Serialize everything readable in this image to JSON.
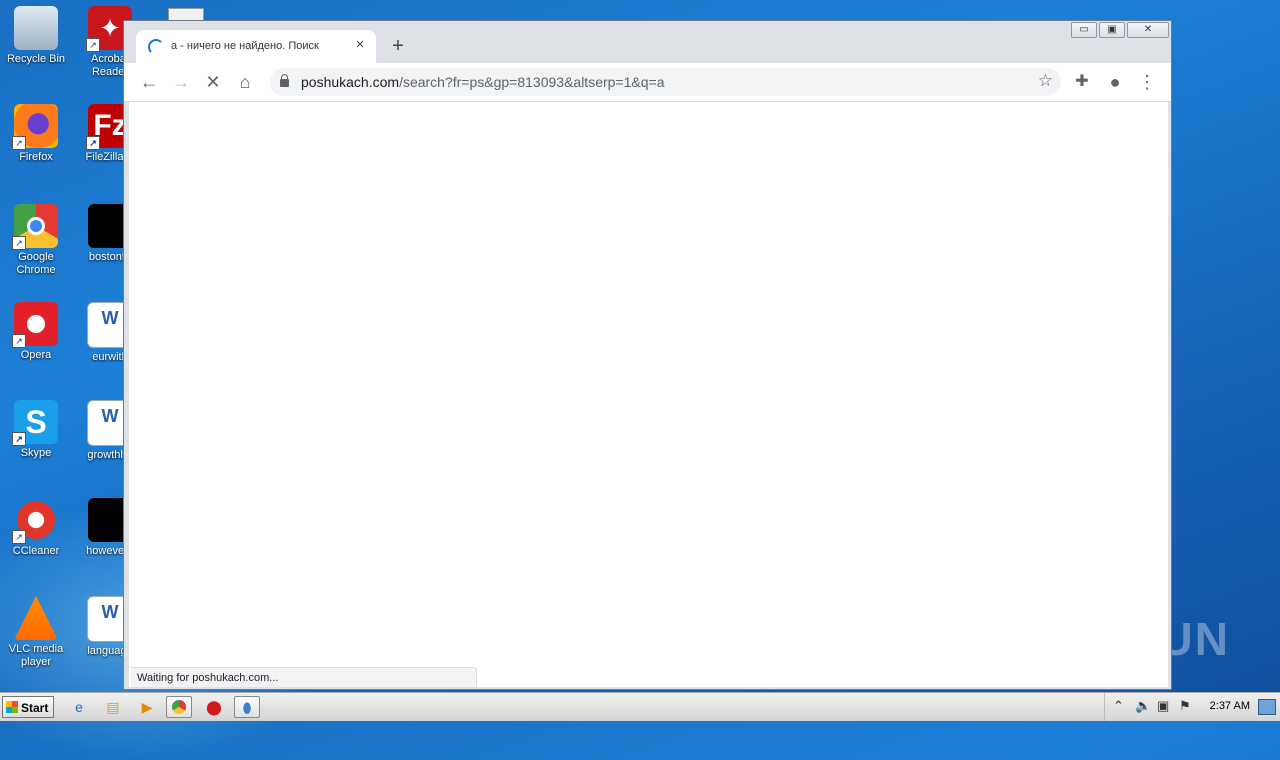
{
  "desktop": {
    "icons": [
      {
        "label": "Recycle Bin",
        "icon": "recycle-bin-icon"
      },
      {
        "label": "Acrobat Reader",
        "icon": "acrobat-icon"
      },
      {
        "label": "Firefox",
        "icon": "firefox-icon"
      },
      {
        "label": "FileZilla C",
        "icon": "filezilla-icon"
      },
      {
        "label": "Google Chrome",
        "icon": "chrome-icon"
      },
      {
        "label": "bostonto",
        "icon": "black-file-icon"
      },
      {
        "label": "Opera",
        "icon": "opera-icon"
      },
      {
        "label": "eurwith",
        "icon": "word-doc-icon"
      },
      {
        "label": "Skype",
        "icon": "skype-icon"
      },
      {
        "label": "growthho",
        "icon": "word-doc-icon"
      },
      {
        "label": "CCleaner",
        "icon": "ccleaner-icon"
      },
      {
        "label": "howevere",
        "icon": "black-file-icon"
      },
      {
        "label": "VLC media player",
        "icon": "vlc-icon"
      },
      {
        "label": "language",
        "icon": "word-doc-icon"
      }
    ],
    "watermark": "ANY RUN"
  },
  "browser": {
    "tab": {
      "title": "а - ничего не найдено. Поиск",
      "close": "×"
    },
    "new_tab": "+",
    "url": {
      "host": "poshukach.com",
      "path": "/search?fr=ps&gp=813093&altserp=1&q=a"
    },
    "status_text": "Waiting for poshukach.com...",
    "window_controls": {
      "minimize": "▭",
      "maximize": "▣",
      "close": "✕"
    }
  },
  "taskbar": {
    "start_label": "Start",
    "clock": "2:37 AM"
  }
}
